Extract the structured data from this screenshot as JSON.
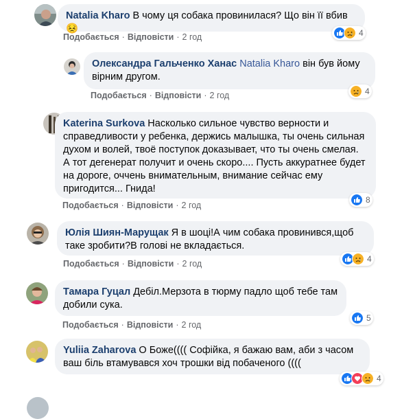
{
  "comments": [
    {
      "author": "Natalia Kharo",
      "mention": "",
      "text": "В чому ця собака провинилася? Що він її вбив😣",
      "actions": {
        "like": "Подобається",
        "reply": "Відповісти",
        "time": "2 год"
      },
      "reactions": {
        "icons": [
          "like-icon",
          "sad-icon"
        ],
        "count": "4"
      }
    },
    {
      "author": "Олександра Гальченко Ханас",
      "mention": "Natalia Kharo",
      "text": "він був йому вірним другом.",
      "actions": {
        "like": "Подобається",
        "reply": "Відповісти",
        "time": "2 год"
      },
      "reactions": {
        "icons": [
          "sad-icon"
        ],
        "count": "4"
      }
    },
    {
      "author": "Katerina Surkova",
      "mention": "",
      "text": "Насколько сильное чувство верности и справедливости у ребенка, держись малышка, ты очень сильная духом и волей, твоё поступок доказывает, что ты очень смелая. А тот дегенерат получит и очень скоро.... Пусть аккуратнее будет на дороге, оччень внимательным, внимание сейчас ему пригодится... Гнида!",
      "actions": {
        "like": "Подобається",
        "reply": "Відповісти",
        "time": "2 год"
      },
      "reactions": {
        "icons": [
          "like-icon"
        ],
        "count": "8"
      }
    },
    {
      "author": "Юлія Шиян-Марущак",
      "mention": "",
      "text": "Я в шоці!А чим собака провинився,щоб таке зробити?В голові не вкладається.",
      "actions": {
        "like": "Подобається",
        "reply": "Відповісти",
        "time": "2 год"
      },
      "reactions": {
        "icons": [
          "like-icon",
          "sad-icon"
        ],
        "count": "4"
      }
    },
    {
      "author": "Тамара Гуцал",
      "mention": "",
      "text": "Дебіл.Мерзота в тюрму падло щоб тебе там добили сука.",
      "actions": {
        "like": "Подобається",
        "reply": "Відповісти",
        "time": "2 год"
      },
      "reactions": {
        "icons": [
          "like-icon"
        ],
        "count": "5"
      }
    },
    {
      "author": "Yuliia Zaharova",
      "mention": "",
      "text": "О Боже(((( Софійка, я бажаю вам, аби з часом ваш біль втамувався хоч трошки від побаченого ((((",
      "actions": {
        "like": "Подобається",
        "reply": "Відповісти",
        "time": "2 год"
      },
      "reactions": {
        "icons": [
          "like-icon",
          "love-icon",
          "sad-icon"
        ],
        "count": "4"
      }
    }
  ]
}
